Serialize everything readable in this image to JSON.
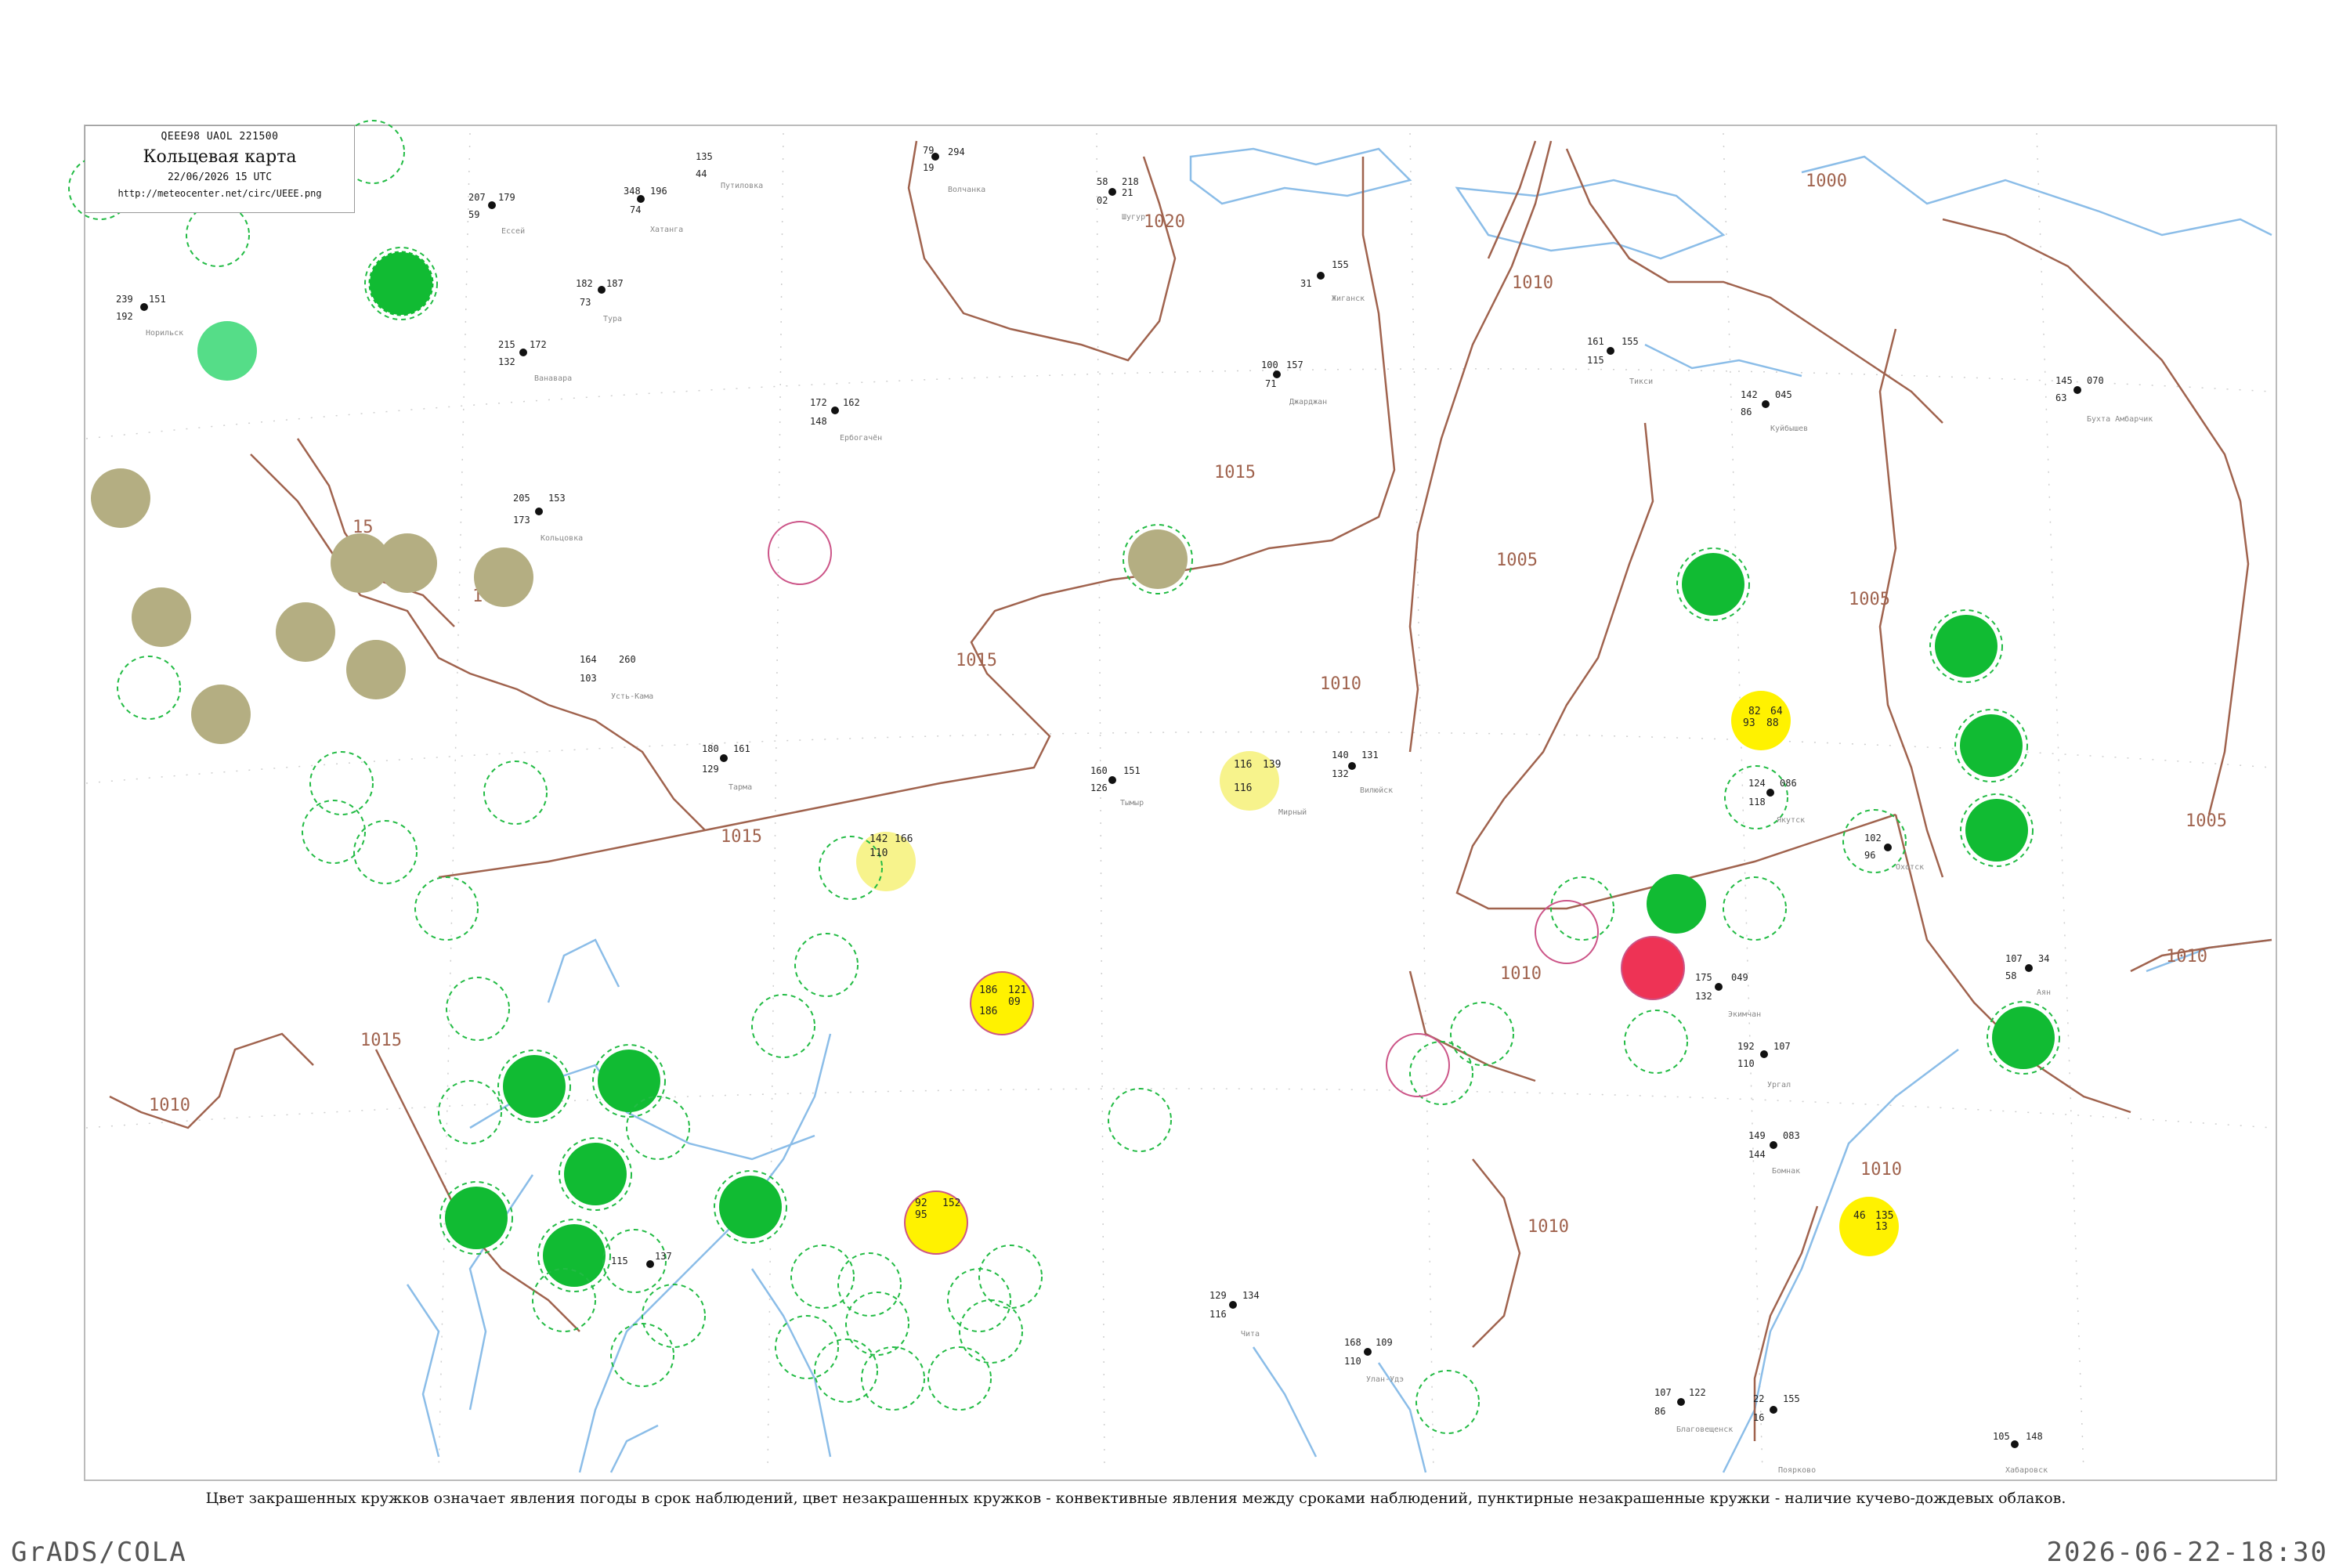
{
  "header": {
    "line1": "QEEE98  UAOL  221500",
    "title": "Кольцевая карта",
    "datetime": "22/06/2026 15 UTC",
    "url": "http://meteocenter.net/circ/UEEE.png"
  },
  "caption": "Цвет закрашенных кружков означает явления погоды в срок наблюдений, цвет незакрашенных кружков - конвективные явления между сроками наблюдений, пунктирные незакрашенные кружки - наличие кучево-дождевых облаков.",
  "footer": {
    "left": "GrADS/COLA",
    "right": "2026-06-22-18:30"
  },
  "colors": {
    "isobar": "#a0634e",
    "coast": "#8bbde8",
    "frame": "#bbbbbb",
    "rain_green": "#11bb33",
    "shower_olive": "#b4ae82",
    "fog_yellow": "#fff200",
    "haze_lightyellow": "#f7f38c",
    "thunder_red": "#ee3355",
    "mint": "#55dd88",
    "dash_green": "#22bb44",
    "dash_pink": "#cc5588"
  },
  "isobar_labels": [
    "1020",
    "1015",
    "1015",
    "1015",
    "1015",
    "1010",
    "1010",
    "1010",
    "1010",
    "1010",
    "1010",
    "1005",
    "1005",
    "1005",
    "1000",
    "15"
  ],
  "stations": [
    {
      "name": "Путиловка",
      "n": [
        "135",
        "44"
      ]
    },
    {
      "name": "Волчанка",
      "n": [
        "79",
        "294",
        "19"
      ]
    },
    {
      "name": "Шугур",
      "n": [
        "58",
        "218",
        "02",
        "21"
      ]
    },
    {
      "name": "Кольцовка",
      "n": [
        "205",
        "153",
        "173"
      ]
    },
    {
      "name": "Усть-Кама",
      "n": [
        "164",
        "260",
        "103"
      ]
    },
    {
      "name": "Тарма",
      "n": [
        "180",
        "161",
        "129"
      ]
    },
    {
      "name": "Тымыр",
      "n": [
        "160",
        "151",
        "126"
      ]
    },
    {
      "name": "Мирный",
      "n": [
        "116",
        "139",
        "115"
      ]
    },
    {
      "name": "Вилюйск",
      "n": [
        "140",
        "131",
        "132"
      ]
    },
    {
      "name": "Жиганск",
      "n": [
        "155",
        "31"
      ]
    },
    {
      "name": "Джарджан",
      "n": [
        "100",
        "157",
        "71"
      ]
    },
    {
      "name": "Тикси",
      "n": [
        "161",
        "155",
        "115"
      ]
    },
    {
      "name": "Куйбышев",
      "n": [
        "142",
        "045",
        "86"
      ]
    },
    {
      "name": "Бухта Амбарчик",
      "n": [
        "145",
        "070",
        "63"
      ]
    },
    {
      "name": "Якутск",
      "n": [
        "124",
        "086",
        "118"
      ]
    },
    {
      "name": "Охотск",
      "n": [
        "102",
        "96"
      ]
    },
    {
      "name": "Аян",
      "n": [
        "107",
        "34",
        "58"
      ]
    },
    {
      "name": "Ургал",
      "n": [
        "192",
        "107",
        "110"
      ]
    },
    {
      "name": "Бомнак",
      "n": [
        "149",
        "083",
        "144"
      ]
    },
    {
      "name": "Экимчан",
      "n": [
        "175",
        "049",
        "132"
      ]
    },
    {
      "name": "Иркутск",
      "n": [
        "115",
        "137"
      ]
    },
    {
      "name": "Чита",
      "n": [
        "129",
        "134",
        "116"
      ]
    },
    {
      "name": "Улан-Удэ",
      "n": [
        "168",
        "109",
        "110"
      ]
    },
    {
      "name": "Благовещенск",
      "n": [
        "107",
        "122",
        "86"
      ]
    },
    {
      "name": "Хабаровск",
      "n": [
        "105",
        "148"
      ]
    },
    {
      "name": "Поярково",
      "n": [
        "22",
        "155",
        "16"
      ]
    },
    {
      "name": "Норильск",
      "n": [
        "239",
        "151",
        "192"
      ]
    },
    {
      "name": "Тура",
      "n": [
        "182",
        "187",
        "73"
      ]
    },
    {
      "name": "Ванавара",
      "n": [
        "215",
        "172",
        "132"
      ]
    },
    {
      "name": "Ербогачён",
      "n": [
        "172",
        "162",
        "148"
      ]
    },
    {
      "name": "Ессей",
      "n": [
        "207",
        "179",
        "59"
      ]
    },
    {
      "name": "Хатанга",
      "n": [
        "348",
        "196",
        "74"
      ]
    }
  ],
  "highlight_values": [
    "186",
    "121",
    "09",
    "82",
    "93",
    "88",
    "64",
    "116",
    "139",
    "142",
    "166",
    "110",
    "152",
    "92",
    "95",
    "46",
    "135",
    "13"
  ]
}
